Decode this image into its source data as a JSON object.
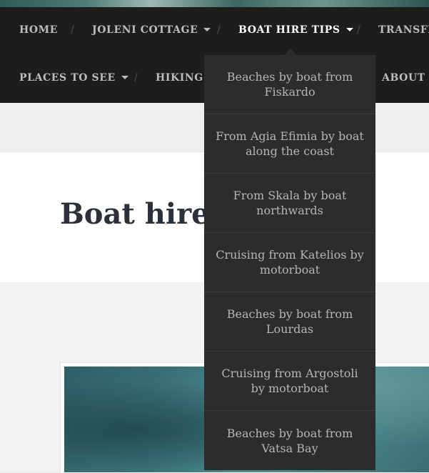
{
  "nav": {
    "row1": [
      {
        "label": "HOME",
        "has_caret": false
      },
      {
        "label": "JOLENI COTTAGE",
        "has_caret": true
      },
      {
        "label": "BOAT HIRE TIPS",
        "has_caret": true,
        "active": true
      },
      {
        "label": "TRANSFE",
        "has_caret": false
      }
    ],
    "row2": [
      {
        "label": "PLACES TO SEE",
        "has_caret": true
      },
      {
        "label": "HIKING &",
        "has_caret": false
      },
      {
        "label": "ABOUT M",
        "has_caret": false
      }
    ],
    "separator": "/"
  },
  "dropdown": {
    "items": [
      "Beaches by boat from Fiskardo",
      "From Agia Efimia by boat along the coast",
      "From Skala by boat northwards",
      "Cruising from Katelios by motorboat",
      "Beaches by boat from Lourdas",
      "Cruising from Argostoli by motorboat",
      "Beaches by boat from Vatsa Bay"
    ]
  },
  "page": {
    "title": "Boat hire t"
  },
  "colors": {
    "nav_bg": "#1d1d1d",
    "dropdown_bg": "#2c2c2c",
    "active_text": "#ffffff",
    "nav_text": "#bdbdbd",
    "title_text": "#2b3139"
  }
}
